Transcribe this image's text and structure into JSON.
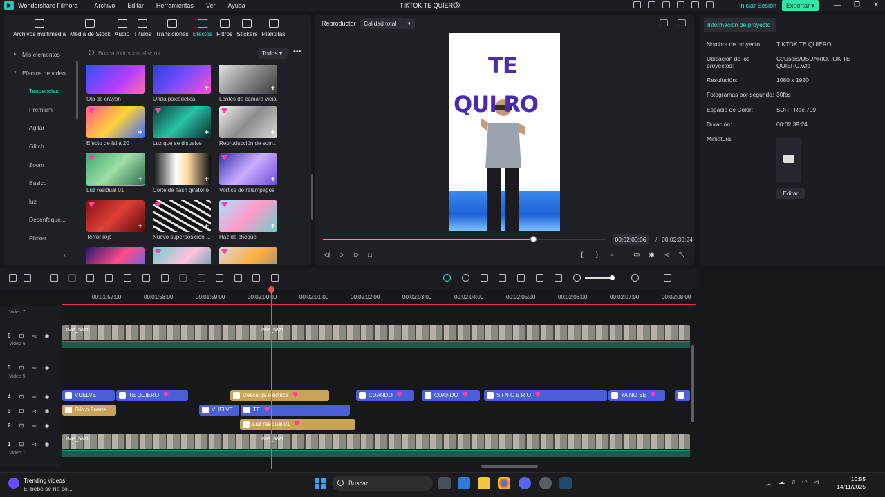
{
  "app": {
    "name": "Wondershare Filmora",
    "menu": [
      "Archivo",
      "Editar",
      "Herramientas",
      "Ver",
      "Ayuda"
    ],
    "project_title": "TIKTOK TE QUIERO",
    "login_label": "Iniciar Sesión",
    "export_label": "Exportar",
    "window_controls": [
      "—",
      "❐",
      "✕"
    ]
  },
  "media_tabs": [
    {
      "label": "Archivos multimedia",
      "icon": "folder-icon"
    },
    {
      "label": "Media de Stock",
      "icon": "stock-icon"
    },
    {
      "label": "Audio",
      "icon": "music-icon"
    },
    {
      "label": "Títulos",
      "icon": "text-icon"
    },
    {
      "label": "Transiciones",
      "icon": "transition-icon"
    },
    {
      "label": "Efectos",
      "icon": "sparkle-icon"
    },
    {
      "label": "Filtros",
      "icon": "filter-icon"
    },
    {
      "label": "Stickers",
      "icon": "sticker-icon"
    },
    {
      "label": "Plantillas",
      "icon": "template-icon"
    }
  ],
  "sidebar": {
    "my_items": "Mis elementos",
    "video_effects": "Efectos de video",
    "items": [
      "Tendencias",
      "Premium",
      "Agitar",
      "Glitch",
      "Zoom",
      "Básico",
      "luz",
      "Desenfoque...",
      "Flicker"
    ]
  },
  "search": {
    "placeholder": "Busca todos los efectos",
    "filter_label": "Todos",
    "more": "•••"
  },
  "effects": [
    "Ola de crayón",
    "Onda psicodélica",
    "Lentes de cámara viejas",
    "Efecto de falla 20",
    "Luz que se disuelve",
    "Reproducción de som...",
    "Luz residual 01",
    "Corte de flash giratorio",
    "Vórtice de relámpagos",
    "Terror rojo",
    "Nuevo superposición ...",
    "Haz de choque"
  ],
  "player": {
    "label": "Reproductor",
    "quality": "Calidad total",
    "video_text_1": "TE",
    "video_text_2": "QUI  RO",
    "current_time": "00:02:00:06",
    "separator": "/",
    "total_time": "00:02:39:24",
    "progress_fraction": 0.745
  },
  "info": {
    "tab": "Información de proyecto",
    "rows": [
      {
        "label": "Nombre de proyecto:",
        "value": "TIKTOK TE QUIERO"
      },
      {
        "label": "Ubicación de los proyectos:",
        "value": "C:/Users/USUARIO...OK TE QUIERO.wfp"
      },
      {
        "label": "Resolución:",
        "value": "1080 x 1920"
      },
      {
        "label": "Fotogramas por segundo:",
        "value": "30fps"
      },
      {
        "label": "Espacio de Color:",
        "value": "SDR - Rec.709"
      },
      {
        "label": "Duración:",
        "value": "00:02:39:24"
      },
      {
        "label": "Miniatura:",
        "value": ""
      }
    ],
    "edit_label": "Editar"
  },
  "timeline": {
    "ruler": [
      "00:01:57:00",
      "00:01:58:00",
      "00:01:59:00",
      "00:02:00:00",
      "00:02:01:00",
      "00:02:02:00",
      "00:02:03:00",
      "00:02:04:00",
      "00:02:05:00",
      "00:02:06:00",
      "00:02:07:00",
      "00:02:08:00"
    ],
    "tracks": [
      "Video 7",
      "Video 6",
      "Video 5",
      "Video 1"
    ],
    "track_numbers": [
      "6",
      "5",
      "4",
      "3",
      "2",
      "1"
    ],
    "video_clip_name": "IMG_5821",
    "clips_track4": [
      "VUELVE",
      "TE QUIERO",
      "Descarga eléctrica",
      "CUANDO",
      "CUANDO",
      "S I N C E R O",
      "YA NO SE"
    ],
    "clips_track3": [
      "Glitch Fuerte",
      "VUELVE",
      "TE"
    ],
    "clips_track2": [
      "Luz residual 01"
    ]
  },
  "taskbar": {
    "weather_title": "Trending videos",
    "weather_sub": "El bebé se ríe co...",
    "search_label": "Buscar",
    "time": "10:55",
    "date": "14/11/2025"
  }
}
